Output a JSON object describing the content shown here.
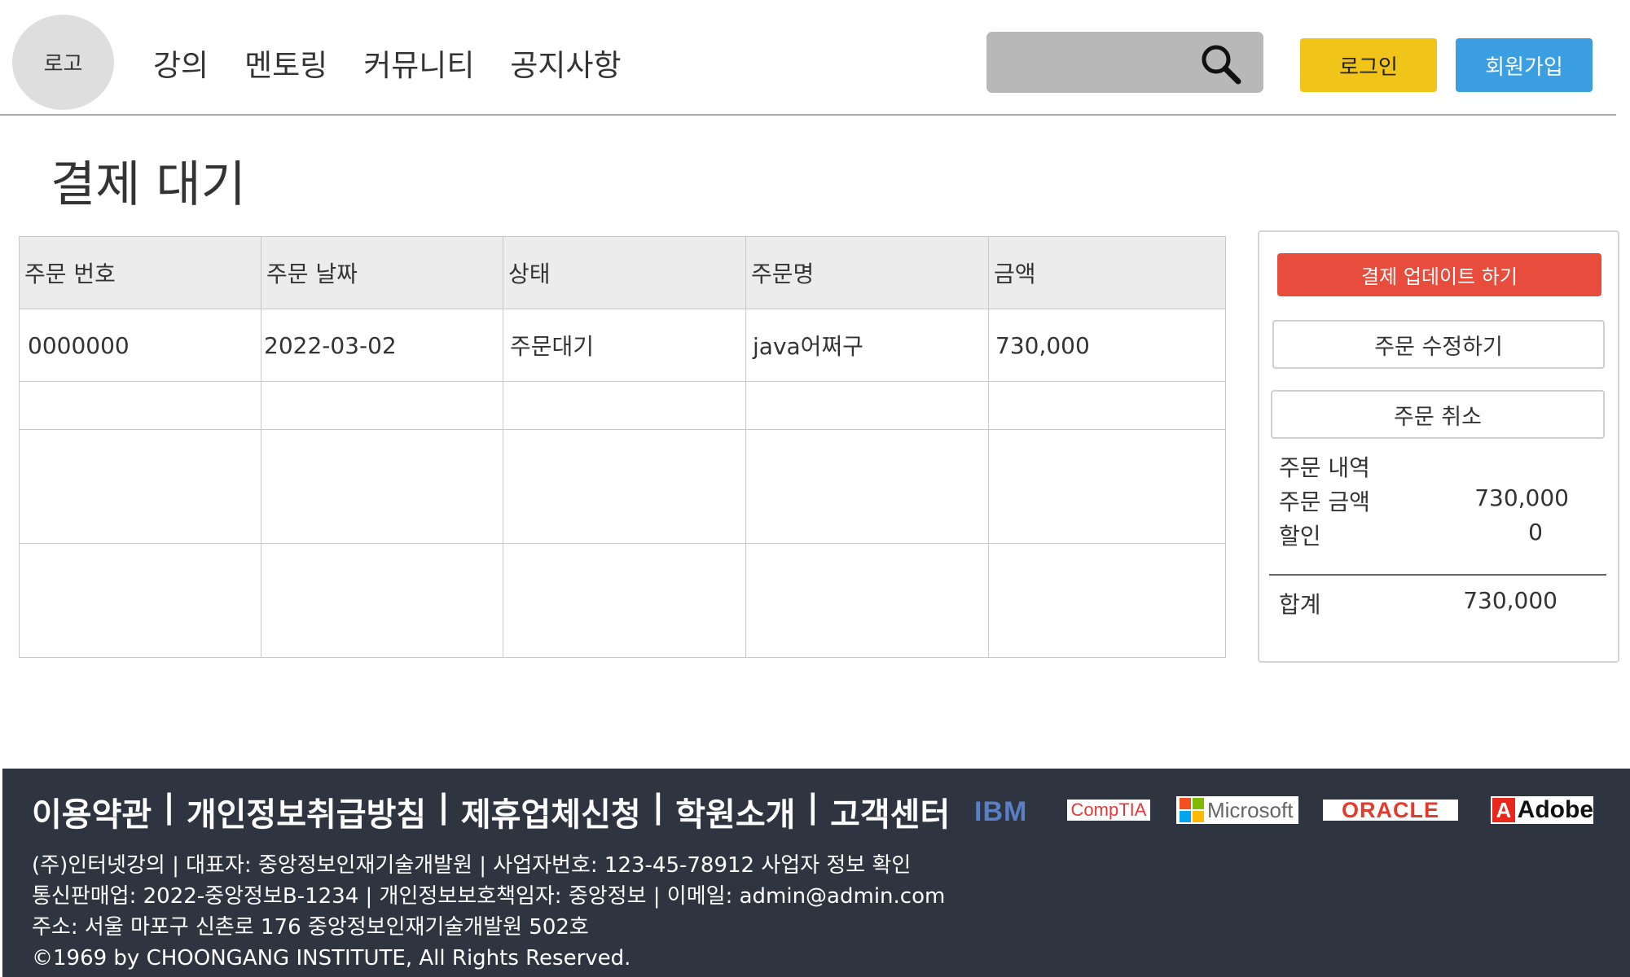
{
  "header": {
    "logo": "로고",
    "nav": [
      "강의",
      "멘토링",
      "커뮤니티",
      "공지사항"
    ],
    "search_placeholder": "",
    "login": "로그인",
    "join": "회원가입"
  },
  "page": {
    "title": "결제 대기"
  },
  "table": {
    "headers": [
      "주문 번호",
      "주문 날짜",
      "상태",
      "주문명",
      "금액"
    ],
    "rows": [
      [
        "0000000",
        "2022-03-02",
        "주문대기",
        "java어쩌구",
        "730,000"
      ]
    ]
  },
  "panel": {
    "update_button": "결제 업데이트 하기",
    "edit_button": "주문 수정하기",
    "cancel_button": "주문 취소",
    "summary_title": "주문 내역",
    "order_amount_label": "주문 금액",
    "order_amount": "730,000",
    "discount_label": "할인",
    "discount": "0",
    "total_label": "합계",
    "total": "730,000"
  },
  "footer": {
    "links": [
      "이용약관",
      "개인정보취급방침",
      "제휴업체신청",
      "학원소개",
      "고객센터"
    ],
    "partners": [
      "IBM",
      "CompTIA",
      "Microsoft",
      "ORACLE",
      "Adobe"
    ],
    "info": [
      "(주)인터넷강의 | 대표자: 중앙정보인재기술개발원 | 사업자번호: 123-45-78912 사업자 정보 확인",
      "통신판매업: 2022-중앙정보B-1234 | 개인정보보호책임자: 중앙정보 | 이메일: admin@admin.com",
      "주소: 서울 마포구 신촌로 176 중앙정보인재기술개발원 502호",
      "©1969 by CHOONGANG INSTITUTE, All Rights Reserved."
    ]
  },
  "colors": {
    "login": "#f0c419",
    "join": "#3b9ee0",
    "update": "#e84c3d",
    "footer_bg": "#2f3540"
  }
}
